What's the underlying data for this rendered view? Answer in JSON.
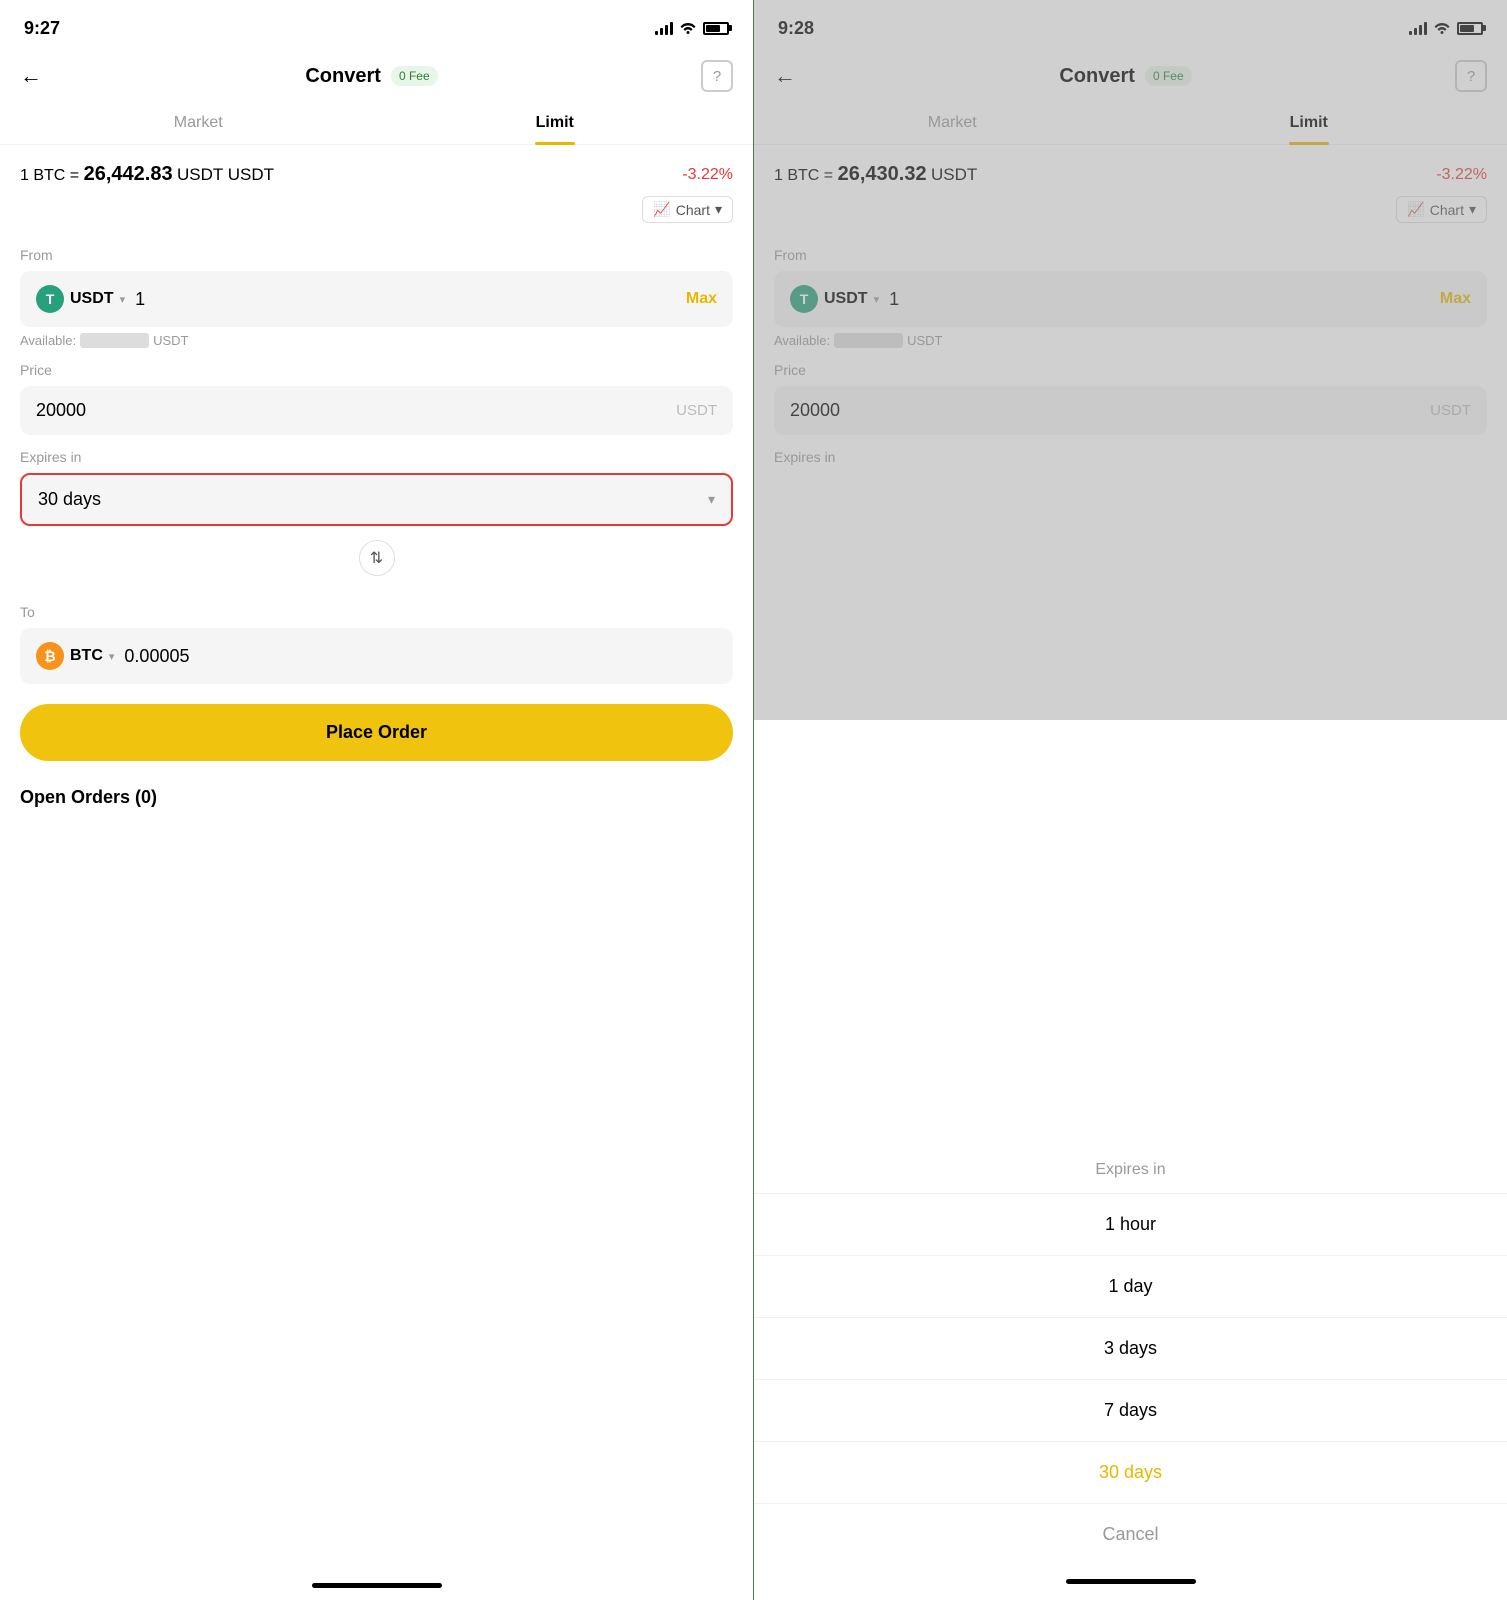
{
  "left": {
    "statusBar": {
      "time": "9:27"
    },
    "header": {
      "title": "Convert",
      "fee": "0 Fee",
      "helpIcon": "?"
    },
    "tabs": [
      {
        "label": "Market",
        "active": false
      },
      {
        "label": "Limit",
        "active": true
      }
    ],
    "priceRow": {
      "prefix": "1 BTC =",
      "rate": "26,442.83",
      "suffix": "USDT",
      "change": "-3.22%"
    },
    "chartBtn": "Chart",
    "fromLabel": "From",
    "fromCurrency": "USDT",
    "fromAmount": "1",
    "maxLabel": "Max",
    "availableLabel": "Available:",
    "availableCurrency": "USDT",
    "priceLabel": "Price",
    "priceValue": "20000",
    "priceUnit": "USDT",
    "expiresLabel": "Expires in",
    "expiresValue": "30 days",
    "toLabel": "To",
    "toCurrency": "BTC",
    "toAmount": "0.00005",
    "placeOrderBtn": "Place Order",
    "openOrders": "Open Orders (0)"
  },
  "right": {
    "statusBar": {
      "time": "9:28"
    },
    "header": {
      "title": "Convert",
      "fee": "0 Fee",
      "helpIcon": "?"
    },
    "tabs": [
      {
        "label": "Market",
        "active": false
      },
      {
        "label": "Limit",
        "active": true
      }
    ],
    "priceRow": {
      "prefix": "1 BTC =",
      "rate": "26,430.32",
      "suffix": "USDT",
      "change": "-3.22%"
    },
    "chartBtn": "Chart",
    "fromLabel": "From",
    "fromCurrency": "USDT",
    "fromAmount": "1",
    "maxLabel": "Max",
    "availableLabel": "Available:",
    "availableCurrency": "USDT",
    "priceLabel": "Price",
    "priceValue": "20000",
    "priceUnit": "USDT",
    "expiresLabel": "Expires in",
    "picker": {
      "header": "Expires in",
      "options": [
        {
          "label": "1 hour",
          "selected": false
        },
        {
          "label": "1 day",
          "selected": false
        },
        {
          "label": "3 days",
          "selected": false
        },
        {
          "label": "7 days",
          "selected": false
        },
        {
          "label": "30 days",
          "selected": true
        },
        {
          "label": "Cancel",
          "cancel": true
        }
      ]
    }
  }
}
